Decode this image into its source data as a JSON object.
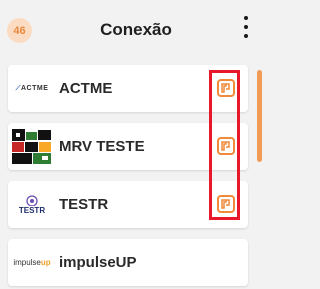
{
  "header": {
    "badge_count": "46",
    "title": "Conexão",
    "menu_icon": "kebab-vertical-icon"
  },
  "connections": [
    {
      "name": "ACTME",
      "logo_text": "ACTME",
      "action_icon": "connect-plug-icon"
    },
    {
      "name": "MRV TESTE",
      "action_icon": "connect-plug-icon"
    },
    {
      "name": "TESTR",
      "logo_text": "TESTR",
      "action_icon": "connect-plug-icon"
    },
    {
      "name": "impulseUP",
      "logo_text_main": "impulse",
      "logo_text_accent": "up"
    }
  ],
  "colors": {
    "accent": "#f08a3a",
    "badge_bg": "#fbdcc3",
    "highlight": "#e8182a",
    "background": "#f2f2f2"
  }
}
